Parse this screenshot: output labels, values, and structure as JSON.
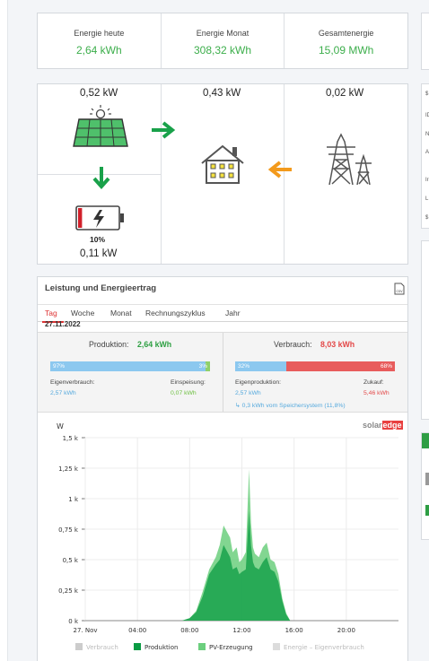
{
  "summary": [
    {
      "label": "Energie heute",
      "value": "2,64 kWh"
    },
    {
      "label": "Energie Monat",
      "value": "308,32 kWh"
    },
    {
      "label": "Gesamtenergie",
      "value": "15,09 MWh"
    }
  ],
  "flow": {
    "pv_power": "0,52 kW",
    "house_power": "0,43 kW",
    "grid_power": "0,02 kW",
    "battery_percent": "10%",
    "battery_level": 0.1,
    "battery_power": "0,11 kW"
  },
  "chart_panel": {
    "title": "Leistung und Energieertrag",
    "export_icon_label": "CSV",
    "tabs": [
      "Tag",
      "Woche",
      "Monat",
      "Rechnungszyklus",
      "Jahr"
    ],
    "active_tab": "Tag",
    "date": "27.11.2022",
    "production": {
      "label": "Produktion:",
      "value": "2,64 kWh",
      "self_pct": "97%",
      "feed_pct": "3%",
      "self_fraction": 0.97,
      "self_label": "Eigenverbrauch:",
      "self_value": "2,57 kWh",
      "feed_label": "Einspeisung:",
      "feed_value": "0,07 kWh"
    },
    "consumption": {
      "label": "Verbrauch:",
      "value": "8,03 kWh",
      "self_pct": "32%",
      "import_pct": "68%",
      "self_fraction": 0.32,
      "self_label": "Eigenproduktion:",
      "self_value": "2,57 kWh",
      "import_label": "Zukauf:",
      "import_value": "5,46 kWh",
      "storage_note": "↳ 0,3 kWh vom Speichersystem (11,8%)"
    },
    "brand_left": "solar",
    "brand_right": "edge"
  },
  "chart_data": {
    "type": "area",
    "ylabel": "W",
    "ylim": [
      0,
      1500
    ],
    "y_ticks": [
      "0 k",
      "0,25 k",
      "0,5 k",
      "0,75 k",
      "1 k",
      "1,25 k",
      "1,5 k"
    ],
    "x_ticks": [
      "27. Nov",
      "04:00",
      "08:00",
      "12:00",
      "16:00",
      "20:00"
    ],
    "x_tick_hours": [
      0,
      4,
      8,
      12,
      16,
      20
    ],
    "x_range_hours": [
      0,
      24
    ],
    "legend": [
      "Verbrauch",
      "Produktion",
      "PV-Erzeugung",
      "Energie – Eigenverbrauch"
    ],
    "colors": {
      "Verbrauch": "#cccccc",
      "Produktion": "#0a9b43",
      "PV-Erzeugung": "#6ccf7e",
      "Energie – Eigenverbrauch": "#dcdcdc"
    },
    "series": [
      {
        "name": "PV-Erzeugung",
        "x": [
          7.4,
          8.0,
          8.5,
          9.0,
          9.5,
          10.0,
          10.3,
          10.6,
          10.9,
          11.1,
          11.3,
          11.6,
          11.8,
          12.0,
          12.3,
          12.55,
          12.7,
          12.85,
          13.0,
          13.3,
          13.6,
          13.9,
          14.2,
          14.5,
          14.8,
          15.1,
          15.4,
          15.7
        ],
        "y": [
          0,
          20,
          80,
          240,
          420,
          520,
          620,
          780,
          720,
          680,
          560,
          600,
          480,
          500,
          560,
          1240,
          800,
          600,
          550,
          520,
          600,
          640,
          500,
          480,
          380,
          180,
          60,
          0
        ]
      },
      {
        "name": "Produktion",
        "x": [
          7.4,
          8.0,
          8.5,
          9.0,
          9.5,
          10.0,
          10.3,
          10.6,
          10.9,
          11.1,
          11.3,
          11.6,
          11.8,
          12.0,
          12.3,
          12.55,
          12.7,
          12.85,
          13.0,
          13.3,
          13.6,
          13.9,
          14.2,
          14.5,
          14.8,
          15.1,
          15.4,
          15.7
        ],
        "y": [
          0,
          20,
          70,
          200,
          380,
          460,
          500,
          620,
          560,
          520,
          420,
          440,
          380,
          400,
          420,
          900,
          620,
          480,
          440,
          420,
          480,
          520,
          420,
          400,
          320,
          160,
          50,
          0
        ]
      }
    ]
  }
}
